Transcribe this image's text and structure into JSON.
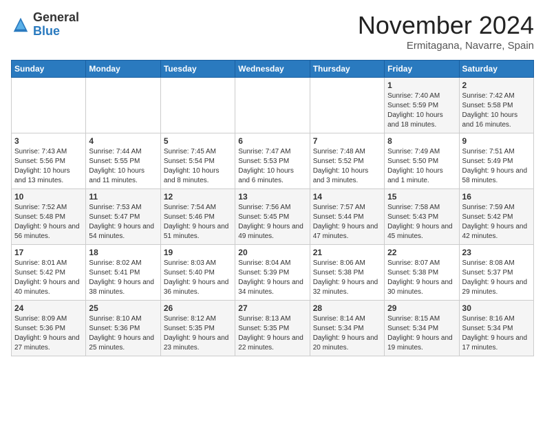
{
  "logo": {
    "general": "General",
    "blue": "Blue"
  },
  "title": "November 2024",
  "location": "Ermitagana, Navarre, Spain",
  "days_of_week": [
    "Sunday",
    "Monday",
    "Tuesday",
    "Wednesday",
    "Thursday",
    "Friday",
    "Saturday"
  ],
  "weeks": [
    [
      {
        "day": "",
        "info": ""
      },
      {
        "day": "",
        "info": ""
      },
      {
        "day": "",
        "info": ""
      },
      {
        "day": "",
        "info": ""
      },
      {
        "day": "",
        "info": ""
      },
      {
        "day": "1",
        "info": "Sunrise: 7:40 AM\nSunset: 5:59 PM\nDaylight: 10 hours and 18 minutes."
      },
      {
        "day": "2",
        "info": "Sunrise: 7:42 AM\nSunset: 5:58 PM\nDaylight: 10 hours and 16 minutes."
      }
    ],
    [
      {
        "day": "3",
        "info": "Sunrise: 7:43 AM\nSunset: 5:56 PM\nDaylight: 10 hours and 13 minutes."
      },
      {
        "day": "4",
        "info": "Sunrise: 7:44 AM\nSunset: 5:55 PM\nDaylight: 10 hours and 11 minutes."
      },
      {
        "day": "5",
        "info": "Sunrise: 7:45 AM\nSunset: 5:54 PM\nDaylight: 10 hours and 8 minutes."
      },
      {
        "day": "6",
        "info": "Sunrise: 7:47 AM\nSunset: 5:53 PM\nDaylight: 10 hours and 6 minutes."
      },
      {
        "day": "7",
        "info": "Sunrise: 7:48 AM\nSunset: 5:52 PM\nDaylight: 10 hours and 3 minutes."
      },
      {
        "day": "8",
        "info": "Sunrise: 7:49 AM\nSunset: 5:50 PM\nDaylight: 10 hours and 1 minute."
      },
      {
        "day": "9",
        "info": "Sunrise: 7:51 AM\nSunset: 5:49 PM\nDaylight: 9 hours and 58 minutes."
      }
    ],
    [
      {
        "day": "10",
        "info": "Sunrise: 7:52 AM\nSunset: 5:48 PM\nDaylight: 9 hours and 56 minutes."
      },
      {
        "day": "11",
        "info": "Sunrise: 7:53 AM\nSunset: 5:47 PM\nDaylight: 9 hours and 54 minutes."
      },
      {
        "day": "12",
        "info": "Sunrise: 7:54 AM\nSunset: 5:46 PM\nDaylight: 9 hours and 51 minutes."
      },
      {
        "day": "13",
        "info": "Sunrise: 7:56 AM\nSunset: 5:45 PM\nDaylight: 9 hours and 49 minutes."
      },
      {
        "day": "14",
        "info": "Sunrise: 7:57 AM\nSunset: 5:44 PM\nDaylight: 9 hours and 47 minutes."
      },
      {
        "day": "15",
        "info": "Sunrise: 7:58 AM\nSunset: 5:43 PM\nDaylight: 9 hours and 45 minutes."
      },
      {
        "day": "16",
        "info": "Sunrise: 7:59 AM\nSunset: 5:42 PM\nDaylight: 9 hours and 42 minutes."
      }
    ],
    [
      {
        "day": "17",
        "info": "Sunrise: 8:01 AM\nSunset: 5:42 PM\nDaylight: 9 hours and 40 minutes."
      },
      {
        "day": "18",
        "info": "Sunrise: 8:02 AM\nSunset: 5:41 PM\nDaylight: 9 hours and 38 minutes."
      },
      {
        "day": "19",
        "info": "Sunrise: 8:03 AM\nSunset: 5:40 PM\nDaylight: 9 hours and 36 minutes."
      },
      {
        "day": "20",
        "info": "Sunrise: 8:04 AM\nSunset: 5:39 PM\nDaylight: 9 hours and 34 minutes."
      },
      {
        "day": "21",
        "info": "Sunrise: 8:06 AM\nSunset: 5:38 PM\nDaylight: 9 hours and 32 minutes."
      },
      {
        "day": "22",
        "info": "Sunrise: 8:07 AM\nSunset: 5:38 PM\nDaylight: 9 hours and 30 minutes."
      },
      {
        "day": "23",
        "info": "Sunrise: 8:08 AM\nSunset: 5:37 PM\nDaylight: 9 hours and 29 minutes."
      }
    ],
    [
      {
        "day": "24",
        "info": "Sunrise: 8:09 AM\nSunset: 5:36 PM\nDaylight: 9 hours and 27 minutes."
      },
      {
        "day": "25",
        "info": "Sunrise: 8:10 AM\nSunset: 5:36 PM\nDaylight: 9 hours and 25 minutes."
      },
      {
        "day": "26",
        "info": "Sunrise: 8:12 AM\nSunset: 5:35 PM\nDaylight: 9 hours and 23 minutes."
      },
      {
        "day": "27",
        "info": "Sunrise: 8:13 AM\nSunset: 5:35 PM\nDaylight: 9 hours and 22 minutes."
      },
      {
        "day": "28",
        "info": "Sunrise: 8:14 AM\nSunset: 5:34 PM\nDaylight: 9 hours and 20 minutes."
      },
      {
        "day": "29",
        "info": "Sunrise: 8:15 AM\nSunset: 5:34 PM\nDaylight: 9 hours and 19 minutes."
      },
      {
        "day": "30",
        "info": "Sunrise: 8:16 AM\nSunset: 5:34 PM\nDaylight: 9 hours and 17 minutes."
      }
    ]
  ]
}
